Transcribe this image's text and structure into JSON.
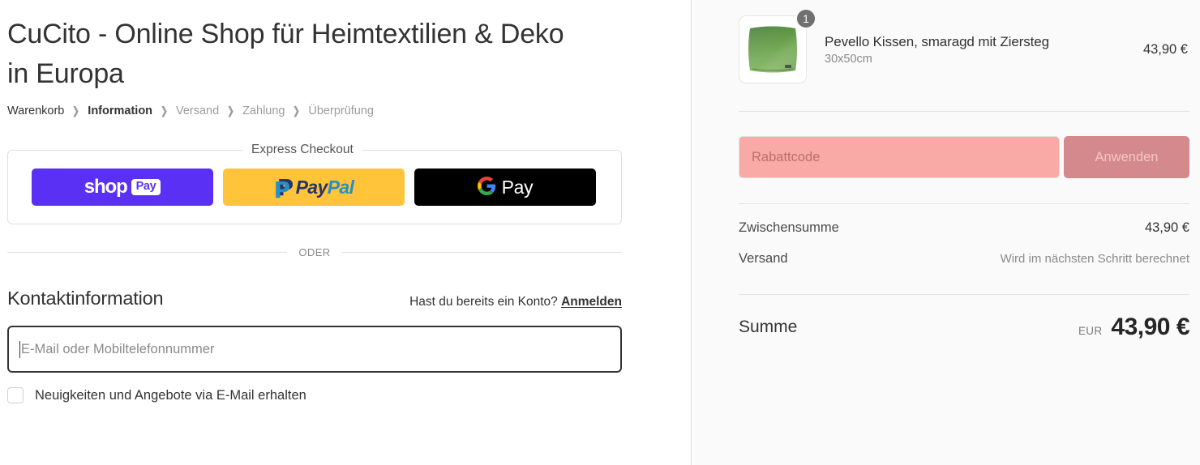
{
  "shop": {
    "title": "CuCito - Online Shop für Heimtextilien & Deko in Europa"
  },
  "breadcrumb": {
    "separator": "❯",
    "items": [
      {
        "label": "Warenkorb",
        "state": "link"
      },
      {
        "label": "Information",
        "state": "active"
      },
      {
        "label": "Versand",
        "state": "dim"
      },
      {
        "label": "Zahlung",
        "state": "dim"
      },
      {
        "label": "Überprüfung",
        "state": "dim"
      }
    ]
  },
  "express": {
    "legend": "Express Checkout",
    "buttons": [
      {
        "name": "shop-pay",
        "word": "shop",
        "badge": "Pay",
        "bg": "#5A31F4"
      },
      {
        "name": "paypal",
        "pay": "Pay",
        "pal": "Pal",
        "bg": "#FFC439"
      },
      {
        "name": "google-pay",
        "label": "Pay",
        "bg": "#000000"
      }
    ]
  },
  "divider": {
    "or_label": "ODER"
  },
  "contact": {
    "title": "Kontaktinformation",
    "login_prompt": "Hast du bereits ein Konto?",
    "login_link": "Anmelden",
    "email_placeholder": "E-Mail oder Mobiltelefonnummer",
    "email_value": "",
    "newsletter_label": "Neuigkeiten und Angebote via E-Mail erhalten",
    "newsletter_checked": false
  },
  "summary": {
    "line_items": [
      {
        "title": "Pevello Kissen, smaragd mit Ziersteg",
        "variant": "30x50cm",
        "quantity": "1",
        "price": "43,90 €",
        "image_alt": "green-velvet-cushion"
      }
    ],
    "discount": {
      "placeholder": "Rabattcode",
      "value": "",
      "apply_label": "Anwenden",
      "input_bg": "#F9AAA7",
      "button_bg": "#D4898C"
    },
    "totals": [
      {
        "label": "Zwischensumme",
        "value": "43,90 €",
        "muted": false
      },
      {
        "label": "Versand",
        "value": "Wird im nächsten Schritt berechnet",
        "muted": true
      }
    ],
    "grand_total": {
      "label": "Summe",
      "currency": "EUR",
      "amount": "43,90 €"
    }
  }
}
